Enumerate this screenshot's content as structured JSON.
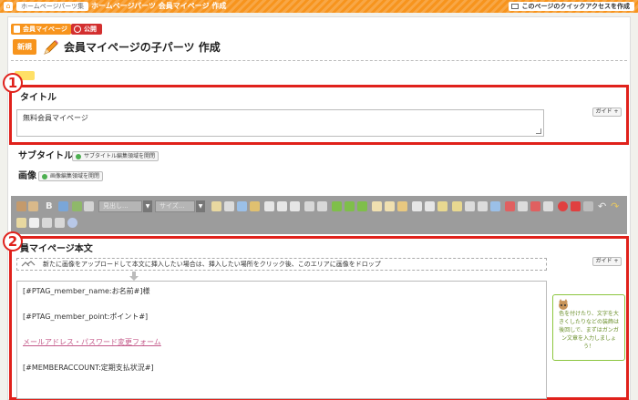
{
  "topbar": {
    "home_icon": "home-icon",
    "breadcrumb": "ホームページパーツ集",
    "separator": "›",
    "current": "ホームページパーツ 会員マイページ 作成",
    "quick_access": "このページのクイックアクセスを作成"
  },
  "tags": {
    "mypage": "会員マイページ",
    "public": "公開"
  },
  "header": {
    "new_badge": "新規",
    "title": "会員マイページの子パーツ 作成"
  },
  "fields": {
    "title": {
      "marker": "1",
      "label": "タイトル",
      "value": "無料会員マイページ",
      "guide": "ガイド +"
    },
    "subtitle": {
      "label": "サブタイトル",
      "button": "サブタイトル編集領域を開閉"
    },
    "image": {
      "label": "画像",
      "button": "画像編集領域を開閉"
    },
    "body": {
      "marker": "2",
      "label": "員マイページ本文",
      "guide": "ガイド +",
      "dropzone": "新たに画像をアップロードして本文に挿入したい場合は、挿入したい場所をクリック後、このエリアに画像をドロップ",
      "lines": [
        "[#PTAG_member_name:お名前#]様",
        "[#PTAG_member_point:ポイント#]",
        "メールアドレス・パスワード変更フォーム",
        "[#MEMBERACCOUNT:定期支払状況#]"
      ]
    }
  },
  "toolbar": {
    "heading_select": "見出し...",
    "size_select": "サイズ..."
  },
  "tip": {
    "text": "色を付けたり、文字を大きくしたりなどの装飾は後回しで、まずはガンガン文章を入力しましょう！"
  },
  "colors": {
    "accent": "#f7941d",
    "highlight": "#e0211b",
    "tip_border": "#8cc63f"
  }
}
